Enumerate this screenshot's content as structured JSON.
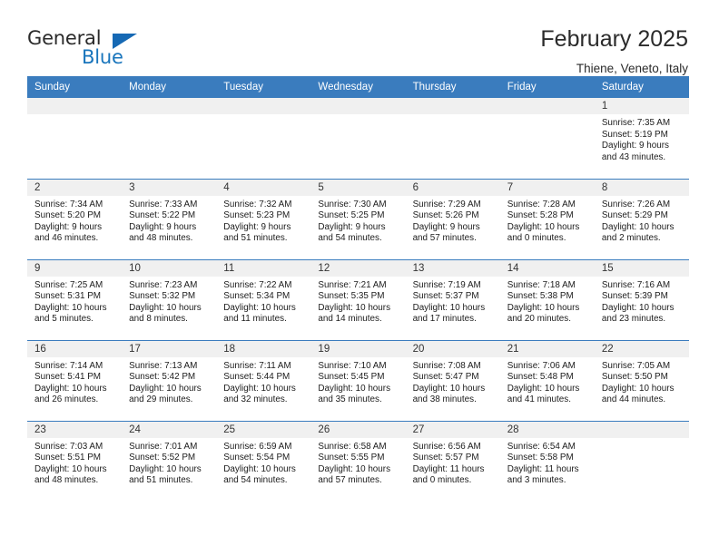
{
  "branding": {
    "logo_primary": "General",
    "logo_secondary": "Blue"
  },
  "header": {
    "title": "February 2025",
    "location": "Thiene, Veneto, Italy"
  },
  "calendar": {
    "weekday_headers": [
      "Sunday",
      "Monday",
      "Tuesday",
      "Wednesday",
      "Thursday",
      "Friday",
      "Saturday"
    ],
    "accent_color": "#3a7cbe",
    "daynum_band_color": "#f0f0f0",
    "weeks": [
      [
        {
          "day": "",
          "empty": true
        },
        {
          "day": "",
          "empty": true
        },
        {
          "day": "",
          "empty": true
        },
        {
          "day": "",
          "empty": true
        },
        {
          "day": "",
          "empty": true
        },
        {
          "day": "",
          "empty": true
        },
        {
          "day": "1",
          "sunrise": "Sunrise: 7:35 AM",
          "sunset": "Sunset: 5:19 PM",
          "daylight": "Daylight: 9 hours and 43 minutes."
        }
      ],
      [
        {
          "day": "2",
          "sunrise": "Sunrise: 7:34 AM",
          "sunset": "Sunset: 5:20 PM",
          "daylight": "Daylight: 9 hours and 46 minutes."
        },
        {
          "day": "3",
          "sunrise": "Sunrise: 7:33 AM",
          "sunset": "Sunset: 5:22 PM",
          "daylight": "Daylight: 9 hours and 48 minutes."
        },
        {
          "day": "4",
          "sunrise": "Sunrise: 7:32 AM",
          "sunset": "Sunset: 5:23 PM",
          "daylight": "Daylight: 9 hours and 51 minutes."
        },
        {
          "day": "5",
          "sunrise": "Sunrise: 7:30 AM",
          "sunset": "Sunset: 5:25 PM",
          "daylight": "Daylight: 9 hours and 54 minutes."
        },
        {
          "day": "6",
          "sunrise": "Sunrise: 7:29 AM",
          "sunset": "Sunset: 5:26 PM",
          "daylight": "Daylight: 9 hours and 57 minutes."
        },
        {
          "day": "7",
          "sunrise": "Sunrise: 7:28 AM",
          "sunset": "Sunset: 5:28 PM",
          "daylight": "Daylight: 10 hours and 0 minutes."
        },
        {
          "day": "8",
          "sunrise": "Sunrise: 7:26 AM",
          "sunset": "Sunset: 5:29 PM",
          "daylight": "Daylight: 10 hours and 2 minutes."
        }
      ],
      [
        {
          "day": "9",
          "sunrise": "Sunrise: 7:25 AM",
          "sunset": "Sunset: 5:31 PM",
          "daylight": "Daylight: 10 hours and 5 minutes."
        },
        {
          "day": "10",
          "sunrise": "Sunrise: 7:23 AM",
          "sunset": "Sunset: 5:32 PM",
          "daylight": "Daylight: 10 hours and 8 minutes."
        },
        {
          "day": "11",
          "sunrise": "Sunrise: 7:22 AM",
          "sunset": "Sunset: 5:34 PM",
          "daylight": "Daylight: 10 hours and 11 minutes."
        },
        {
          "day": "12",
          "sunrise": "Sunrise: 7:21 AM",
          "sunset": "Sunset: 5:35 PM",
          "daylight": "Daylight: 10 hours and 14 minutes."
        },
        {
          "day": "13",
          "sunrise": "Sunrise: 7:19 AM",
          "sunset": "Sunset: 5:37 PM",
          "daylight": "Daylight: 10 hours and 17 minutes."
        },
        {
          "day": "14",
          "sunrise": "Sunrise: 7:18 AM",
          "sunset": "Sunset: 5:38 PM",
          "daylight": "Daylight: 10 hours and 20 minutes."
        },
        {
          "day": "15",
          "sunrise": "Sunrise: 7:16 AM",
          "sunset": "Sunset: 5:39 PM",
          "daylight": "Daylight: 10 hours and 23 minutes."
        }
      ],
      [
        {
          "day": "16",
          "sunrise": "Sunrise: 7:14 AM",
          "sunset": "Sunset: 5:41 PM",
          "daylight": "Daylight: 10 hours and 26 minutes."
        },
        {
          "day": "17",
          "sunrise": "Sunrise: 7:13 AM",
          "sunset": "Sunset: 5:42 PM",
          "daylight": "Daylight: 10 hours and 29 minutes."
        },
        {
          "day": "18",
          "sunrise": "Sunrise: 7:11 AM",
          "sunset": "Sunset: 5:44 PM",
          "daylight": "Daylight: 10 hours and 32 minutes."
        },
        {
          "day": "19",
          "sunrise": "Sunrise: 7:10 AM",
          "sunset": "Sunset: 5:45 PM",
          "daylight": "Daylight: 10 hours and 35 minutes."
        },
        {
          "day": "20",
          "sunrise": "Sunrise: 7:08 AM",
          "sunset": "Sunset: 5:47 PM",
          "daylight": "Daylight: 10 hours and 38 minutes."
        },
        {
          "day": "21",
          "sunrise": "Sunrise: 7:06 AM",
          "sunset": "Sunset: 5:48 PM",
          "daylight": "Daylight: 10 hours and 41 minutes."
        },
        {
          "day": "22",
          "sunrise": "Sunrise: 7:05 AM",
          "sunset": "Sunset: 5:50 PM",
          "daylight": "Daylight: 10 hours and 44 minutes."
        }
      ],
      [
        {
          "day": "23",
          "sunrise": "Sunrise: 7:03 AM",
          "sunset": "Sunset: 5:51 PM",
          "daylight": "Daylight: 10 hours and 48 minutes."
        },
        {
          "day": "24",
          "sunrise": "Sunrise: 7:01 AM",
          "sunset": "Sunset: 5:52 PM",
          "daylight": "Daylight: 10 hours and 51 minutes."
        },
        {
          "day": "25",
          "sunrise": "Sunrise: 6:59 AM",
          "sunset": "Sunset: 5:54 PM",
          "daylight": "Daylight: 10 hours and 54 minutes."
        },
        {
          "day": "26",
          "sunrise": "Sunrise: 6:58 AM",
          "sunset": "Sunset: 5:55 PM",
          "daylight": "Daylight: 10 hours and 57 minutes."
        },
        {
          "day": "27",
          "sunrise": "Sunrise: 6:56 AM",
          "sunset": "Sunset: 5:57 PM",
          "daylight": "Daylight: 11 hours and 0 minutes."
        },
        {
          "day": "28",
          "sunrise": "Sunrise: 6:54 AM",
          "sunset": "Sunset: 5:58 PM",
          "daylight": "Daylight: 11 hours and 3 minutes."
        },
        {
          "day": "",
          "empty": true
        }
      ]
    ]
  }
}
